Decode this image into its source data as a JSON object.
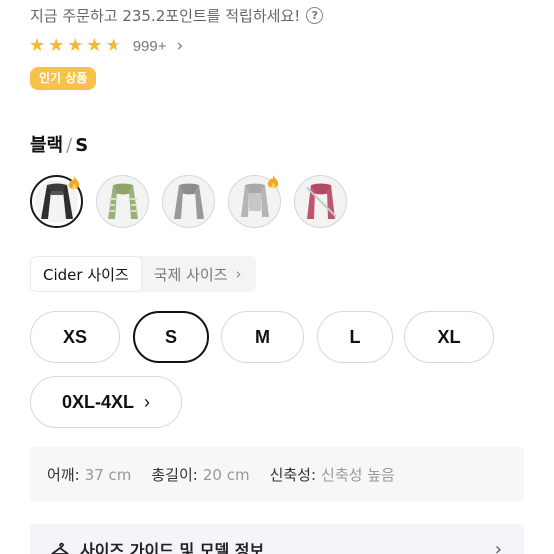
{
  "points": {
    "text": "지금 주문하고 235.2포인트를 적립하세요!",
    "help_icon": "question-circle-icon"
  },
  "rating": {
    "stars": 4.5,
    "review_count": "999+"
  },
  "badge": {
    "label": "인기 상품",
    "color": "#f7c14b"
  },
  "selection": {
    "color": "블랙",
    "separator": "/",
    "size": "S"
  },
  "swatches": [
    {
      "name": "black",
      "selected": true,
      "hot": true,
      "sold_out": false
    },
    {
      "name": "green-stripe",
      "selected": false,
      "hot": false,
      "sold_out": false
    },
    {
      "name": "grey",
      "selected": false,
      "hot": false,
      "sold_out": false
    },
    {
      "name": "light-grey",
      "selected": false,
      "hot": true,
      "sold_out": false
    },
    {
      "name": "pink",
      "selected": false,
      "hot": false,
      "sold_out": true
    }
  ],
  "size_tabs": {
    "active": "Cider 사이즈",
    "inactive": "국제 사이즈"
  },
  "sizes": [
    {
      "label": "XS",
      "selected": false
    },
    {
      "label": "S",
      "selected": true
    },
    {
      "label": "M",
      "selected": false
    },
    {
      "label": "L",
      "selected": false
    },
    {
      "label": "XL",
      "selected": false
    },
    {
      "label": "0XL-4XL",
      "selected": false
    }
  ],
  "measurements": {
    "shoulder_label": "어깨:",
    "shoulder_value": "37 cm",
    "length_label": "총길이:",
    "length_value": "20 cm",
    "stretch_label": "신축성:",
    "stretch_value": "신축성 높음"
  },
  "guide": {
    "label": "사이즈 가이드 및 모델 정보"
  }
}
